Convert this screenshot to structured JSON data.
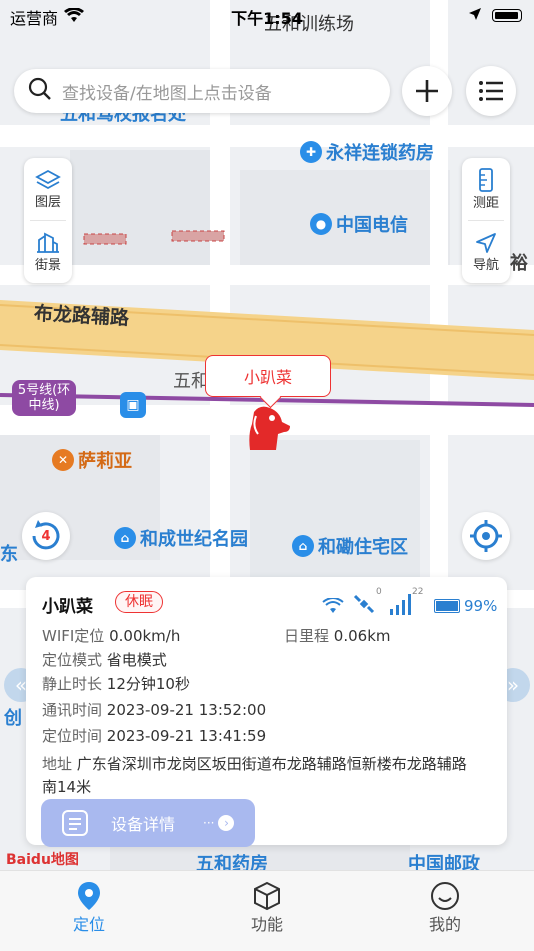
{
  "status_bar": {
    "carrier": "运营商",
    "time": "下午1:54"
  },
  "search": {
    "placeholder": "查找设备/在地图上点击设备"
  },
  "left_tools": [
    {
      "label": "图层"
    },
    {
      "label": "街景"
    }
  ],
  "right_tools": [
    {
      "label": "测距"
    },
    {
      "label": "导航"
    }
  ],
  "map_labels": {
    "top_road": "五和训练场",
    "top_road2": "五和驾校",
    "driving_school": "五和驾校报名处",
    "pharmacy": "永祥连锁药房",
    "telecom": "中国电信",
    "road": "布龙路辅路",
    "metro_line": "5号线(环中线)",
    "station": "五和",
    "restaurant": "萨莉亚",
    "community1": "和成世纪名园",
    "community2": "和磡住宅区",
    "bottom_pharmacy": "五和药房",
    "post_office": "中国邮政",
    "right_edge": "裕",
    "left_edge1": "创",
    "left_edge2": "东"
  },
  "marker": {
    "name": "小趴菜"
  },
  "refresh_counter": "4",
  "device_card": {
    "name": "小趴菜",
    "state": "休眠",
    "satellites": "0",
    "signal": "22",
    "battery": "99%",
    "wifi_speed_label": "WIFI定位",
    "wifi_speed": "0.00km/h",
    "daily_mileage_label": "日里程",
    "daily_mileage": "0.06km",
    "mode_label": "定位模式",
    "mode": "省电模式",
    "still_label": "静止时长",
    "still": "12分钟10秒",
    "comm_label": "通讯时间",
    "comm_time": "2023-09-21 13:52:00",
    "loc_label": "定位时间",
    "loc_time": "2023-09-21 13:41:59",
    "addr_label": "地址",
    "addr_line1": "广东省深圳市龙岗区坂田街道布龙路辅路恒新楼布龙路辅路",
    "addr_line2": "南14米",
    "detail_button": "设备详情"
  },
  "map_logo": "Baidu地图",
  "nav": [
    {
      "label": "定位"
    },
    {
      "label": "功能"
    },
    {
      "label": "我的"
    }
  ],
  "colors": {
    "accent": "#2a8ee8",
    "alert": "#e33333",
    "road": "#f5d38a"
  }
}
